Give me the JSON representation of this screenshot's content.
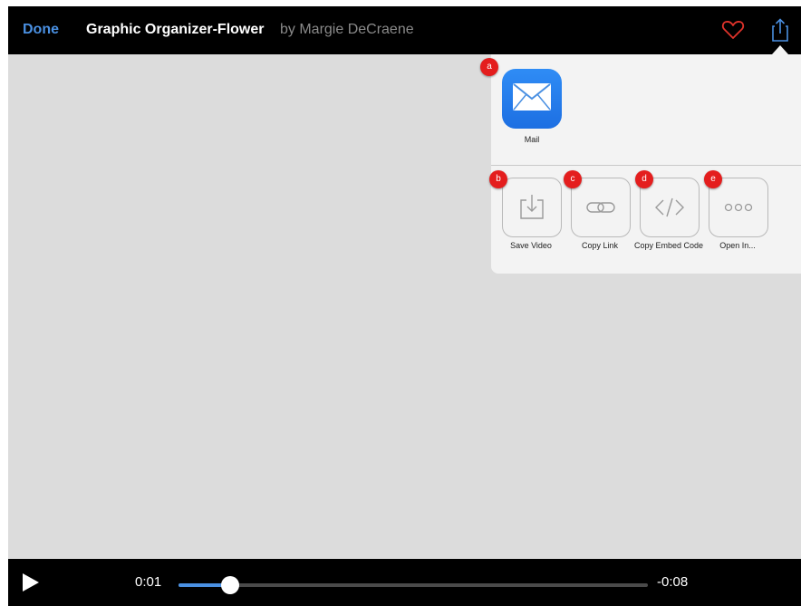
{
  "header": {
    "done_label": "Done",
    "title": "Graphic Organizer-Flower",
    "byline": "by Margie DeCraene",
    "heart_icon": "heart-outline-icon",
    "share_icon": "share-icon",
    "heart_color": "#e0332b",
    "accent_color": "#4a90e2"
  },
  "share_sheet": {
    "apps": [
      {
        "label": "Mail",
        "badge": "a",
        "icon": "mail-icon"
      }
    ],
    "actions": [
      {
        "label": "Save Video",
        "badge": "b",
        "icon": "save-download-icon"
      },
      {
        "label": "Copy Link",
        "badge": "c",
        "icon": "link-icon"
      },
      {
        "label": "Copy Embed Code",
        "badge": "d",
        "icon": "embed-code-icon"
      },
      {
        "label": "Open In...",
        "badge": "e",
        "icon": "more-icon"
      }
    ]
  },
  "player": {
    "elapsed": "0:01",
    "remaining": "-0:08",
    "progress_fraction": 0.11,
    "play_icon": "play-icon"
  }
}
